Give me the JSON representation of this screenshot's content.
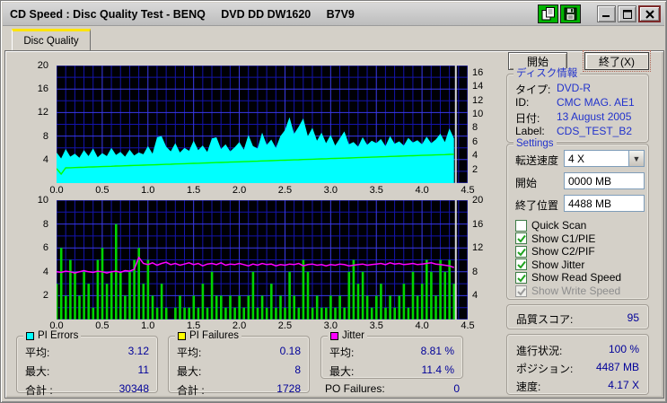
{
  "window": {
    "title": "CD Speed : Disc Quality Test - BENQ     DVD DD DW1620     B7V9"
  },
  "icons": [
    "copy-icon",
    "save-icon",
    "minimize-icon",
    "maximize-icon",
    "close-icon",
    "chevron-down-icon"
  ],
  "tabs": [
    {
      "label": "Disc Quality"
    }
  ],
  "buttons": {
    "start": "開始",
    "exit": "終了(X)"
  },
  "disc_info": {
    "title": "ディスク情報",
    "rows": [
      {
        "label": "タイプ:",
        "value": "DVD-R"
      },
      {
        "label": "ID:",
        "value": "CMC MAG. AE1"
      },
      {
        "label": "日付:",
        "value": "13 August 2005"
      },
      {
        "label": "Label:",
        "value": "CDS_TEST_B2"
      }
    ]
  },
  "settings": {
    "title": "Settings",
    "speed_label": "転送速度",
    "speed_value": "4 X",
    "start_label": "開始",
    "start_value": "0000 MB",
    "end_label": "終了位置",
    "end_value": "4488 MB",
    "checkboxes": [
      {
        "label": "Quick Scan",
        "checked": false,
        "disabled": false
      },
      {
        "label": "Show C1/PIE",
        "checked": true,
        "disabled": false
      },
      {
        "label": "Show C2/PIF",
        "checked": true,
        "disabled": false
      },
      {
        "label": "Show Jitter",
        "checked": true,
        "disabled": false
      },
      {
        "label": "Show Read Speed",
        "checked": true,
        "disabled": false
      },
      {
        "label": "Show Write Speed",
        "checked": true,
        "disabled": true
      }
    ]
  },
  "score": {
    "label": "品質スコア:",
    "value": "95"
  },
  "status": {
    "rows": [
      {
        "label": "進行状況:",
        "value": "100 %"
      },
      {
        "label": "ポジション:",
        "value": "4487 MB"
      },
      {
        "label": "速度:",
        "value": "4.17 X"
      }
    ]
  },
  "stats": {
    "pi_errors": {
      "title": "PI Errors",
      "color": "#00ffff",
      "rows": [
        {
          "label": "平均:",
          "value": "3.12"
        },
        {
          "label": "最大:",
          "value": "11"
        },
        {
          "label": "合計 :",
          "value": "30348"
        }
      ]
    },
    "pi_failures": {
      "title": "PI Failures",
      "color": "#ffff00",
      "rows": [
        {
          "label": "平均:",
          "value": "0.18"
        },
        {
          "label": "最大:",
          "value": "8"
        },
        {
          "label": "合計 :",
          "value": "1728"
        }
      ]
    },
    "jitter": {
      "title": "Jitter",
      "color": "#ff00ff",
      "rows": [
        {
          "label": "平均:",
          "value": "8.81 %"
        },
        {
          "label": "最大:",
          "value": "11.4 %"
        }
      ]
    },
    "po_failures": {
      "label": "PO Failures:",
      "value": "0"
    }
  },
  "colors": {
    "plot_bg": "#000005",
    "grid_minor": "#1414ac",
    "grid_major": "#3a3ae8",
    "pi_errors_area": "#00ffff",
    "read_speed_line": "#00ff00",
    "pi_failures_bar": "#00d400",
    "jitter_line": "#ff00ff",
    "cursor": "#d8d8d8",
    "tab_stripe": "#ffe400",
    "value_blue": "#2233cc",
    "stat_blue": "#000099"
  },
  "chart_data": [
    {
      "type": "area",
      "title": "PI Errors / Read Speed",
      "x_step": 0.05,
      "x_max": 4.5,
      "x_minor": 0.1,
      "x_major": 0.5,
      "x_ticks": [
        "0.0",
        "0.5",
        "1.0",
        "1.5",
        "2.0",
        "2.5",
        "3.0",
        "3.5",
        "4.0",
        "4.5"
      ],
      "left_axis": {
        "max": 20,
        "minor": 2,
        "major_every": 4,
        "ticks": [
          20,
          16,
          12,
          8,
          4
        ]
      },
      "right_axis": {
        "max": 17,
        "ticks": [
          16,
          14,
          12,
          10,
          8,
          6,
          4,
          2
        ]
      },
      "cursor_x": 4.37,
      "pi_errors": [
        5.2,
        4.2,
        5.8,
        4.5,
        5.0,
        4.3,
        5.6,
        4.6,
        5.9,
        4.4,
        5.1,
        4.6,
        6.0,
        4.8,
        5.3,
        4.5,
        5.7,
        4.7,
        5.2,
        4.9,
        6.3,
        5.0,
        7.8,
        8.0,
        6.2,
        5.4,
        6.8,
        5.2,
        6.0,
        5.5,
        7.2,
        5.6,
        6.4,
        5.3,
        7.6,
        7.8,
        5.8,
        6.6,
        5.4,
        6.1,
        7.0,
        5.7,
        8.2,
        6.3,
        5.9,
        8.6,
        6.5,
        7.4,
        6.0,
        8.0,
        9.0,
        11.2,
        8.4,
        9.6,
        11.0,
        8.0,
        9.4,
        7.2,
        8.6,
        6.8,
        8.2,
        6.4,
        7.6,
        8.8,
        6.6,
        7.0,
        6.2,
        7.8,
        6.5,
        7.2,
        6.8,
        7.5,
        6.3,
        8.0,
        6.7,
        7.1,
        6.4,
        7.7,
        6.9,
        7.3,
        6.6,
        7.9,
        6.8,
        7.4,
        8.4,
        7.0,
        9.3,
        7.6
      ],
      "read_speed": [
        2.1,
        1.3,
        2.2,
        2.22,
        2.25,
        2.27,
        2.29,
        2.32,
        2.34,
        2.36,
        2.39,
        2.41,
        2.43,
        2.46,
        2.48,
        2.5,
        2.53,
        2.55,
        2.57,
        2.6,
        2.62,
        2.64,
        2.66,
        2.69,
        2.71,
        2.73,
        2.76,
        2.78,
        2.8,
        2.83,
        2.85,
        2.87,
        2.9,
        2.92,
        2.94,
        2.97,
        2.99,
        3.01,
        3.04,
        3.06,
        3.08,
        3.1,
        3.13,
        3.15,
        3.17,
        3.2,
        3.22,
        3.24,
        3.27,
        3.29,
        3.31,
        3.34,
        3.36,
        3.38,
        3.41,
        3.43,
        3.45,
        3.48,
        3.5,
        3.52,
        3.55,
        3.57,
        3.59,
        3.61,
        3.64,
        3.66,
        3.68,
        3.71,
        3.73,
        3.75,
        3.78,
        3.8,
        3.82,
        3.85,
        3.87,
        3.89,
        3.92,
        3.94,
        3.96,
        3.99,
        4.01,
        4.03,
        4.05,
        4.08,
        4.1,
        4.12,
        4.15,
        4.17
      ]
    },
    {
      "type": "bar",
      "title": "PI Failures / Jitter",
      "x_step": 0.05,
      "x_max": 4.5,
      "x_minor": 0.1,
      "x_major": 0.5,
      "x_ticks": [
        "0.0",
        "0.5",
        "1.0",
        "1.5",
        "2.0",
        "2.5",
        "3.0",
        "3.5",
        "4.0",
        "4.5"
      ],
      "left_axis": {
        "max": 10,
        "minor": 1,
        "major_every": 2,
        "ticks": [
          10,
          8,
          6,
          4,
          2
        ]
      },
      "right_axis": {
        "max": 20,
        "ticks": [
          20,
          16,
          12,
          8,
          4
        ]
      },
      "cursor_x": 4.37,
      "pi_failures": [
        3,
        6,
        2,
        5,
        4,
        2,
        4,
        3,
        1,
        5,
        6,
        3,
        4,
        8,
        4,
        2,
        4,
        5,
        6,
        3,
        5,
        2,
        1,
        3,
        1,
        0,
        1,
        2,
        1,
        1,
        2,
        1,
        3,
        1,
        4,
        2,
        2,
        1,
        2,
        1,
        2,
        1,
        2,
        4,
        1,
        2,
        1,
        3,
        1,
        2,
        1,
        4,
        2,
        1,
        5,
        4,
        1,
        2,
        1,
        1,
        2,
        1,
        2,
        1,
        4,
        5,
        3,
        4,
        2,
        1,
        2,
        3,
        1,
        2,
        1,
        2,
        3,
        1,
        4,
        2,
        3,
        5,
        4,
        2,
        5,
        4,
        5,
        3
      ],
      "jitter": [
        4.0,
        3.95,
        4.05,
        4.0,
        3.9,
        4.0,
        4.1,
        4.0,
        3.95,
        4.05,
        4.0,
        3.9,
        4.0,
        4.05,
        3.95,
        4.1,
        4.05,
        4.2,
        5.2,
        4.7,
        4.6,
        4.75,
        4.55,
        4.7,
        4.8,
        4.6,
        4.7,
        4.55,
        4.65,
        4.75,
        4.6,
        4.7,
        4.5,
        4.65,
        4.7,
        4.6,
        4.75,
        4.55,
        4.65,
        4.6,
        4.7,
        4.6,
        4.5,
        4.65,
        4.55,
        4.7,
        4.6,
        4.65,
        4.5,
        4.6,
        4.55,
        4.65,
        4.6,
        4.7,
        4.5,
        4.6,
        4.65,
        4.55,
        4.6,
        4.5,
        4.6,
        4.55,
        4.65,
        4.6,
        4.5,
        4.55,
        4.6,
        4.65,
        4.55,
        4.6,
        4.65,
        4.7,
        4.6,
        4.75,
        4.65,
        4.7,
        4.6,
        4.65,
        4.7,
        4.6,
        4.65,
        4.7,
        4.75,
        4.65,
        4.6,
        4.55,
        4.5,
        4.35
      ]
    }
  ]
}
